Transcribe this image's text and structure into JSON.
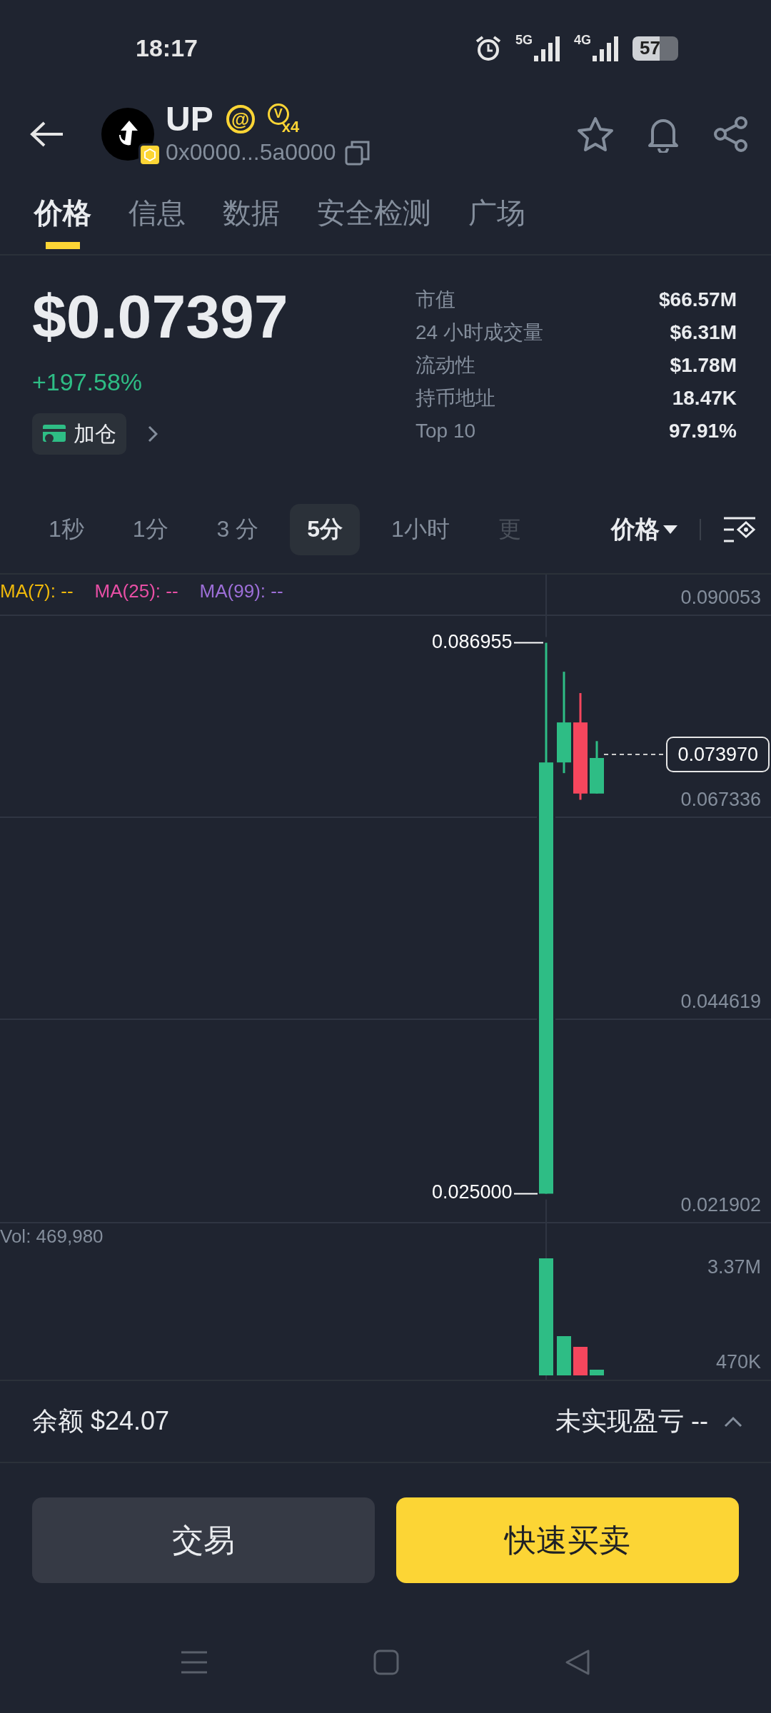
{
  "status_bar": {
    "time": "18:17",
    "networks": [
      "5G",
      "4G"
    ],
    "battery": "57"
  },
  "header": {
    "symbol": "UP",
    "mention": "@",
    "badge_letter": "V",
    "badge_multiplier": "x4",
    "address": "0x0000...5a0000"
  },
  "tabs": [
    {
      "label": "价格",
      "selected": true
    },
    {
      "label": "信息",
      "selected": false
    },
    {
      "label": "数据",
      "selected": false
    },
    {
      "label": "安全检测",
      "selected": false
    },
    {
      "label": "广场",
      "selected": false
    }
  ],
  "price": {
    "value": "$0.07397",
    "change": "+197.58%"
  },
  "add_position": {
    "label": "加仓"
  },
  "stats": [
    {
      "label": "市值",
      "value": "$66.57M"
    },
    {
      "label": "24 小时成交量",
      "value": "$6.31M"
    },
    {
      "label": "流动性",
      "value": "$1.78M"
    },
    {
      "label": "持币地址",
      "value": "18.47K"
    },
    {
      "label": "Top 10",
      "value": "97.91%"
    }
  ],
  "timeframes": [
    {
      "label": "1秒",
      "selected": false
    },
    {
      "label": "1分",
      "selected": false
    },
    {
      "label": "3 分",
      "selected": false
    },
    {
      "label": "5分",
      "selected": true
    },
    {
      "label": "1小时",
      "selected": false
    },
    {
      "label": "更",
      "selected": false
    }
  ],
  "chart_type": "价格",
  "chart": {
    "indicators": [
      {
        "label": "MA(7): --",
        "color": "#f0b90b"
      },
      {
        "label": "MA(25): --",
        "color": "#e84fa5"
      },
      {
        "label": "MA(99): --",
        "color": "#9d6fd8"
      }
    ],
    "price_axis": [
      "0.090053",
      "0.067336",
      "0.044619",
      "0.021902"
    ],
    "high_label": "0.086955",
    "low_label": "0.025000",
    "current_price": "0.073970",
    "volume_label": "Vol: 469,980",
    "volume_axis": [
      "3.37M",
      "470K"
    ]
  },
  "footer": {
    "balance_label": "余额",
    "balance": "$24.07",
    "pnl_label": "未实现盈亏",
    "pnl_value": "--"
  },
  "buttons": [
    {
      "label": "交易",
      "kind": "secondary"
    },
    {
      "label": "快速买卖",
      "kind": "primary"
    }
  ]
}
